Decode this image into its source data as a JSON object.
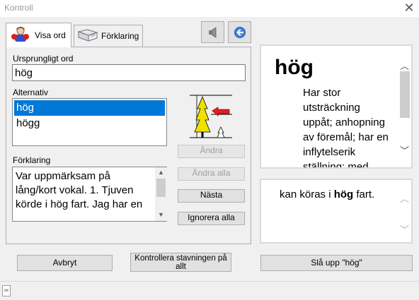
{
  "window": {
    "title": "Kontroll"
  },
  "tabs": [
    {
      "label": "Visa ord"
    },
    {
      "label": "Förklaring"
    }
  ],
  "icons": {
    "tab1": "user-speaker-icon",
    "tab2": "book-icon",
    "speaker": "speaker-icon",
    "back": "back-arrow-icon",
    "tree": "tree-size-icon"
  },
  "original_word": {
    "label": "Ursprungligt ord",
    "value": "hög"
  },
  "alternatives": {
    "label": "Alternativ",
    "items": [
      "hög",
      "högg"
    ],
    "selected_index": 0
  },
  "explanation": {
    "label": "Förklaring",
    "lines": [
      "Var uppmärksam på",
      "lång/kort vokal. 1. Tjuven",
      "körde i hög fart. Jag har en"
    ]
  },
  "buttons": {
    "change": "Ändra",
    "change_all": "Ändra alla",
    "next": "Nästa",
    "ignore_all": "Ignorera alla",
    "cancel": "Avbryt",
    "check_all": "Kontrollera stavningen på allt",
    "lookup": "Slå upp \"hög\""
  },
  "dictionary": {
    "headword": "hög",
    "lines": [
      "Har stor",
      "utsträckning",
      "uppåt; anhopning",
      "av föremål; har en",
      "inflytelserik",
      "ställning; med"
    ]
  },
  "example": {
    "before": "kan köras i ",
    "bold": "hög",
    "after": " fart."
  },
  "status_bar": {
    "icon_text": "xx"
  },
  "colors": {
    "selection": "#0078d7",
    "arrow_red": "#e02020",
    "tree_yellow": "#f0e000",
    "back_blue": "#1e64c8"
  }
}
